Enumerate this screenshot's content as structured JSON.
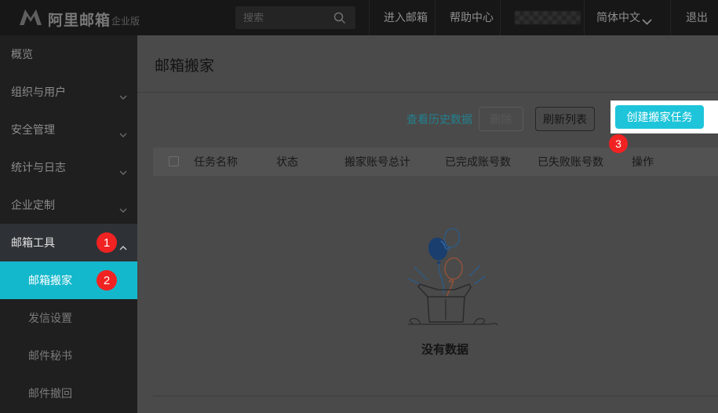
{
  "topbar": {
    "logo_text": "阿里邮箱",
    "logo_badge": "企业版",
    "search_placeholder": "搜索",
    "enter_mail": "进入邮箱",
    "help_center": "帮助中心",
    "language": "简体中文",
    "logout": "退出"
  },
  "sidebar": {
    "items": [
      {
        "label": "概览"
      },
      {
        "label": "组织与用户"
      },
      {
        "label": "安全管理"
      },
      {
        "label": "统计与日志"
      },
      {
        "label": "企业定制"
      },
      {
        "label": "邮箱工具",
        "badge": "1",
        "expanded": true
      },
      {
        "label": "邮箱搬家",
        "badge": "2",
        "selected": true
      },
      {
        "label": "发信设置"
      },
      {
        "label": "邮件秘书"
      },
      {
        "label": "邮件撤回"
      }
    ]
  },
  "main": {
    "title": "邮箱搬家",
    "toolbar": {
      "history_link": "查看历史数据",
      "delete_button": "删除",
      "refresh_button": "刷新列表",
      "create_button": "创建搬家任务",
      "create_badge": "3"
    },
    "table": {
      "headers": [
        "任务名称",
        "状态",
        "搬家账号总计",
        "已完成账号数",
        "已失败账号数",
        "操作"
      ]
    },
    "empty_text": "没有数据"
  },
  "colors": {
    "accent_cyan": "#14b8cc",
    "button_cyan": "#1ec5da",
    "badge_red": "#f12222",
    "link_teal": "#23808f"
  }
}
